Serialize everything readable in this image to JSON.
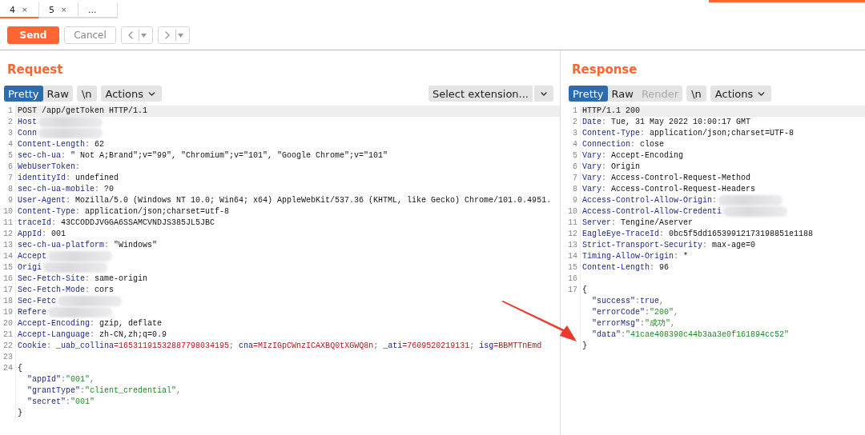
{
  "tabs": [
    {
      "label": "4",
      "close": "×",
      "selected": true
    },
    {
      "label": "5",
      "close": "×",
      "selected": false
    },
    {
      "label": "...",
      "selected": false
    }
  ],
  "toolbar": {
    "send": "Send",
    "cancel": "Cancel",
    "cancel_disabled": true,
    "history_disabled": true
  },
  "request": {
    "title": "Request",
    "view_tabs": [
      {
        "label": "Pretty",
        "selected": true,
        "disabled": false
      },
      {
        "label": "Raw",
        "selected": false,
        "disabled": false
      }
    ],
    "newline": "\\n",
    "actions": "Actions",
    "extension": "Select extension...",
    "lines": [
      {
        "number": "1",
        "current": true,
        "segments": [
          {
            "kind": "plain",
            "text": "POST /app/getToken HTTP/1.1"
          }
        ]
      },
      {
        "number": "2",
        "current": false,
        "segments": [
          {
            "kind": "name",
            "text": "Host"
          },
          {
            "kind": "redacted"
          }
        ]
      },
      {
        "number": "3",
        "current": false,
        "segments": [
          {
            "kind": "name",
            "text": "Conn"
          },
          {
            "kind": "redacted"
          }
        ]
      },
      {
        "number": "4",
        "current": false,
        "segments": [
          {
            "kind": "name",
            "text": "Content-Length"
          },
          {
            "kind": "punct",
            "text": ": "
          },
          {
            "kind": "plain",
            "text": "62"
          }
        ]
      },
      {
        "number": "5",
        "current": false,
        "segments": [
          {
            "kind": "name",
            "text": "sec-ch-ua"
          },
          {
            "kind": "punct",
            "text": ": "
          },
          {
            "kind": "plain",
            "text": "\" Not A;Brand\";v=\"99\", \"Chromium\";v=\"101\", \"Google Chrome\";v=\"101\""
          }
        ]
      },
      {
        "number": "6",
        "current": false,
        "segments": [
          {
            "kind": "name",
            "text": "WebUserToken"
          },
          {
            "kind": "punct",
            "text": ":"
          }
        ]
      },
      {
        "number": "7",
        "current": false,
        "segments": [
          {
            "kind": "name",
            "text": "identityId"
          },
          {
            "kind": "punct",
            "text": ": "
          },
          {
            "kind": "plain",
            "text": "undefined"
          }
        ]
      },
      {
        "number": "8",
        "current": false,
        "segments": [
          {
            "kind": "name",
            "text": "sec-ch-ua-mobile"
          },
          {
            "kind": "punct",
            "text": ": "
          },
          {
            "kind": "plain",
            "text": "?0"
          }
        ]
      },
      {
        "number": "9",
        "current": false,
        "segments": [
          {
            "kind": "name",
            "text": "User-Agent"
          },
          {
            "kind": "punct",
            "text": ": "
          },
          {
            "kind": "plain",
            "text": "Mozilla/5.0 (Windows NT 10.0; Win64; x64) AppleWebKit/537.36 (KHTML, like Gecko) Chrome/101.0.4951."
          }
        ]
      },
      {
        "number": "10",
        "current": false,
        "segments": [
          {
            "kind": "name",
            "text": "Content-Type"
          },
          {
            "kind": "punct",
            "text": ": "
          },
          {
            "kind": "plain",
            "text": "application/json;charset=utf-8"
          }
        ]
      },
      {
        "number": "11",
        "current": false,
        "segments": [
          {
            "kind": "name",
            "text": "traceId"
          },
          {
            "kind": "punct",
            "text": ": "
          },
          {
            "kind": "plain",
            "text": "43CCODDJVGGA6SSAMCVNDJS385JL5JBC"
          }
        ]
      },
      {
        "number": "12",
        "current": false,
        "segments": [
          {
            "kind": "name",
            "text": "AppId"
          },
          {
            "kind": "punct",
            "text": ": "
          },
          {
            "kind": "plain",
            "text": "001"
          }
        ]
      },
      {
        "number": "13",
        "current": false,
        "segments": [
          {
            "kind": "name",
            "text": "sec-ch-ua-platform"
          },
          {
            "kind": "punct",
            "text": ": "
          },
          {
            "kind": "plain",
            "text": "\"Windows\""
          }
        ]
      },
      {
        "number": "14",
        "current": false,
        "segments": [
          {
            "kind": "name",
            "text": "Accept"
          },
          {
            "kind": "redacted"
          }
        ]
      },
      {
        "number": "15",
        "current": false,
        "segments": [
          {
            "kind": "name",
            "text": "Origi"
          },
          {
            "kind": "redacted"
          }
        ]
      },
      {
        "number": "16",
        "current": false,
        "segments": [
          {
            "kind": "name",
            "text": "Sec-Fetch-Site"
          },
          {
            "kind": "punct",
            "text": ": "
          },
          {
            "kind": "plain",
            "text": "same-origin"
          }
        ]
      },
      {
        "number": "17",
        "current": false,
        "segments": [
          {
            "kind": "name",
            "text": "Sec-Fetch-Mode"
          },
          {
            "kind": "punct",
            "text": ": "
          },
          {
            "kind": "plain",
            "text": "cors"
          }
        ]
      },
      {
        "number": "18",
        "current": false,
        "segments": [
          {
            "kind": "name",
            "text": "Sec-Fetc"
          },
          {
            "kind": "redacted"
          }
        ]
      },
      {
        "number": "19",
        "current": false,
        "segments": [
          {
            "kind": "name",
            "text": "Refere"
          },
          {
            "kind": "redacted"
          }
        ]
      },
      {
        "number": "20",
        "current": false,
        "segments": [
          {
            "kind": "name",
            "text": "Accept-Encoding"
          },
          {
            "kind": "punct",
            "text": ": "
          },
          {
            "kind": "plain",
            "text": "gzip, deflate"
          }
        ]
      },
      {
        "number": "21",
        "current": false,
        "segments": [
          {
            "kind": "name",
            "text": "Accept-Language"
          },
          {
            "kind": "punct",
            "text": ": "
          },
          {
            "kind": "plain",
            "text": "zh-CN,zh;q=0.9"
          }
        ]
      },
      {
        "number": "22",
        "current": false,
        "segments": [
          {
            "kind": "name",
            "text": "Cookie"
          },
          {
            "kind": "punct",
            "text": ": "
          },
          {
            "kind": "name",
            "text": "_uab_collina"
          },
          {
            "kind": "value",
            "text": "=16531191532887798034195"
          },
          {
            "kind": "punct",
            "text": "; "
          },
          {
            "kind": "name",
            "text": "cna"
          },
          {
            "kind": "value",
            "text": "=MIzIGpCWnzICAXBQ0tXGWQ8n"
          },
          {
            "kind": "punct",
            "text": "; "
          },
          {
            "kind": "name",
            "text": "_ati"
          },
          {
            "kind": "value",
            "text": "=7609520219131"
          },
          {
            "kind": "punct",
            "text": "; "
          },
          {
            "kind": "name",
            "text": "isg"
          },
          {
            "kind": "value",
            "text": "=BBMTTnEmd"
          }
        ]
      },
      {
        "number": "23",
        "current": false
      },
      {
        "number": "24",
        "current": false,
        "segments": [
          {
            "kind": "plain",
            "text": "{"
          }
        ]
      },
      {
        "current": false,
        "indented": true,
        "segments": [
          {
            "kind": "name",
            "text": "\"appId\""
          },
          {
            "kind": "punct",
            "text": ":"
          },
          {
            "kind": "string",
            "text": "\"001\""
          },
          {
            "kind": "punct",
            "text": ","
          }
        ]
      },
      {
        "current": false,
        "indented": true,
        "segments": [
          {
            "kind": "name",
            "text": "\"grantType\""
          },
          {
            "kind": "punct",
            "text": ":"
          },
          {
            "kind": "string",
            "text": "\"client_credential\""
          },
          {
            "kind": "punct",
            "text": ","
          }
        ]
      },
      {
        "current": false,
        "indented": true,
        "segments": [
          {
            "kind": "name",
            "text": "\"secret\""
          },
          {
            "kind": "punct",
            "text": ":"
          },
          {
            "kind": "string",
            "text": "\"001\""
          }
        ]
      },
      {
        "current": false,
        "indented": false,
        "segments": [
          {
            "kind": "plain",
            "text": "}"
          }
        ]
      }
    ]
  },
  "response": {
    "title": "Response",
    "view_tabs": [
      {
        "label": "Pretty",
        "selected": true,
        "disabled": false
      },
      {
        "label": "Raw",
        "selected": false,
        "disabled": false
      },
      {
        "label": "Render",
        "selected": false,
        "disabled": true
      }
    ],
    "newline": "\\n",
    "actions": "Actions",
    "lines": [
      {
        "number": "1",
        "current": true,
        "segments": [
          {
            "kind": "plain",
            "text": "HTTP/1.1 200"
          }
        ]
      },
      {
        "number": "2",
        "current": false,
        "segments": [
          {
            "kind": "name",
            "text": "Date"
          },
          {
            "kind": "punct",
            "text": ": "
          },
          {
            "kind": "plain",
            "text": "Tue, 31 May 2022 10:00:17 GMT"
          }
        ]
      },
      {
        "number": "3",
        "current": false,
        "segments": [
          {
            "kind": "name",
            "text": "Content-Type"
          },
          {
            "kind": "punct",
            "text": ": "
          },
          {
            "kind": "plain",
            "text": "application/json;charset=UTF-8"
          }
        ]
      },
      {
        "number": "4",
        "current": false,
        "segments": [
          {
            "kind": "name",
            "text": "Connection"
          },
          {
            "kind": "punct",
            "text": ": "
          },
          {
            "kind": "plain",
            "text": "close"
          }
        ]
      },
      {
        "number": "5",
        "current": false,
        "segments": [
          {
            "kind": "name",
            "text": "Vary"
          },
          {
            "kind": "punct",
            "text": ": "
          },
          {
            "kind": "plain",
            "text": "Accept-Encoding"
          }
        ]
      },
      {
        "number": "6",
        "current": false,
        "segments": [
          {
            "kind": "name",
            "text": "Vary"
          },
          {
            "kind": "punct",
            "text": ": "
          },
          {
            "kind": "plain",
            "text": "Origin"
          }
        ]
      },
      {
        "number": "7",
        "current": false,
        "segments": [
          {
            "kind": "name",
            "text": "Vary"
          },
          {
            "kind": "punct",
            "text": ": "
          },
          {
            "kind": "plain",
            "text": "Access-Control-Request-Method"
          }
        ]
      },
      {
        "number": "8",
        "current": false,
        "segments": [
          {
            "kind": "name",
            "text": "Vary"
          },
          {
            "kind": "punct",
            "text": ": "
          },
          {
            "kind": "plain",
            "text": "Access-Control-Request-Headers"
          }
        ]
      },
      {
        "number": "9",
        "current": false,
        "segments": [
          {
            "kind": "name",
            "text": "Access-Control-Allow-Origin"
          },
          {
            "kind": "punct",
            "text": ":"
          },
          {
            "kind": "redacted"
          }
        ]
      },
      {
        "number": "10",
        "current": false,
        "segments": [
          {
            "kind": "name",
            "text": "Access-Control-Allow-Credenti"
          },
          {
            "kind": "redacted"
          }
        ]
      },
      {
        "number": "11",
        "current": false,
        "segments": [
          {
            "kind": "name",
            "text": "Server"
          },
          {
            "kind": "punct",
            "text": ": "
          },
          {
            "kind": "plain",
            "text": "Tengine/Aserver"
          }
        ]
      },
      {
        "number": "12",
        "current": false,
        "segments": [
          {
            "kind": "name",
            "text": "EagleEye-TraceId"
          },
          {
            "kind": "punct",
            "text": ": "
          },
          {
            "kind": "plain",
            "text": "0bc5f5dd16539912173198851e1188"
          }
        ]
      },
      {
        "number": "13",
        "current": false,
        "segments": [
          {
            "kind": "name",
            "text": "Strict-Transport-Security"
          },
          {
            "kind": "punct",
            "text": ": "
          },
          {
            "kind": "plain",
            "text": "max-age=0"
          }
        ]
      },
      {
        "number": "14",
        "current": false,
        "segments": [
          {
            "kind": "name",
            "text": "Timing-Allow-Origin"
          },
          {
            "kind": "punct",
            "text": ": "
          },
          {
            "kind": "plain",
            "text": "*"
          }
        ]
      },
      {
        "number": "15",
        "current": false,
        "segments": [
          {
            "kind": "name",
            "text": "Content-Length"
          },
          {
            "kind": "punct",
            "text": ": "
          },
          {
            "kind": "plain",
            "text": "96"
          }
        ]
      },
      {
        "number": "16",
        "current": false
      },
      {
        "number": "17",
        "current": false,
        "segments": [
          {
            "kind": "plain",
            "text": "{"
          }
        ]
      },
      {
        "current": false,
        "indented": true,
        "segments": [
          {
            "kind": "name",
            "text": "\"success\""
          },
          {
            "kind": "punct",
            "text": ":"
          },
          {
            "kind": "name",
            "text": "true"
          },
          {
            "kind": "punct",
            "text": ","
          }
        ]
      },
      {
        "current": false,
        "indented": true,
        "segments": [
          {
            "kind": "name",
            "text": "\"errorCode\""
          },
          {
            "kind": "punct",
            "text": ":"
          },
          {
            "kind": "string",
            "text": "\"200\""
          },
          {
            "kind": "punct",
            "text": ","
          }
        ]
      },
      {
        "current": false,
        "indented": true,
        "segments": [
          {
            "kind": "name",
            "text": "\"errorMsg\""
          },
          {
            "kind": "punct",
            "text": ":"
          },
          {
            "kind": "string",
            "text": "\"成功\""
          },
          {
            "kind": "punct",
            "text": ","
          }
        ]
      },
      {
        "current": false,
        "indented": true,
        "segments": [
          {
            "kind": "name",
            "text": "\"data\""
          },
          {
            "kind": "punct",
            "text": ":"
          },
          {
            "kind": "string",
            "text": "\"41cae408390c44b3aa3e0f161894cc52\""
          }
        ]
      },
      {
        "current": false,
        "indented": false,
        "segments": [
          {
            "kind": "plain",
            "text": "}"
          }
        ]
      }
    ]
  }
}
